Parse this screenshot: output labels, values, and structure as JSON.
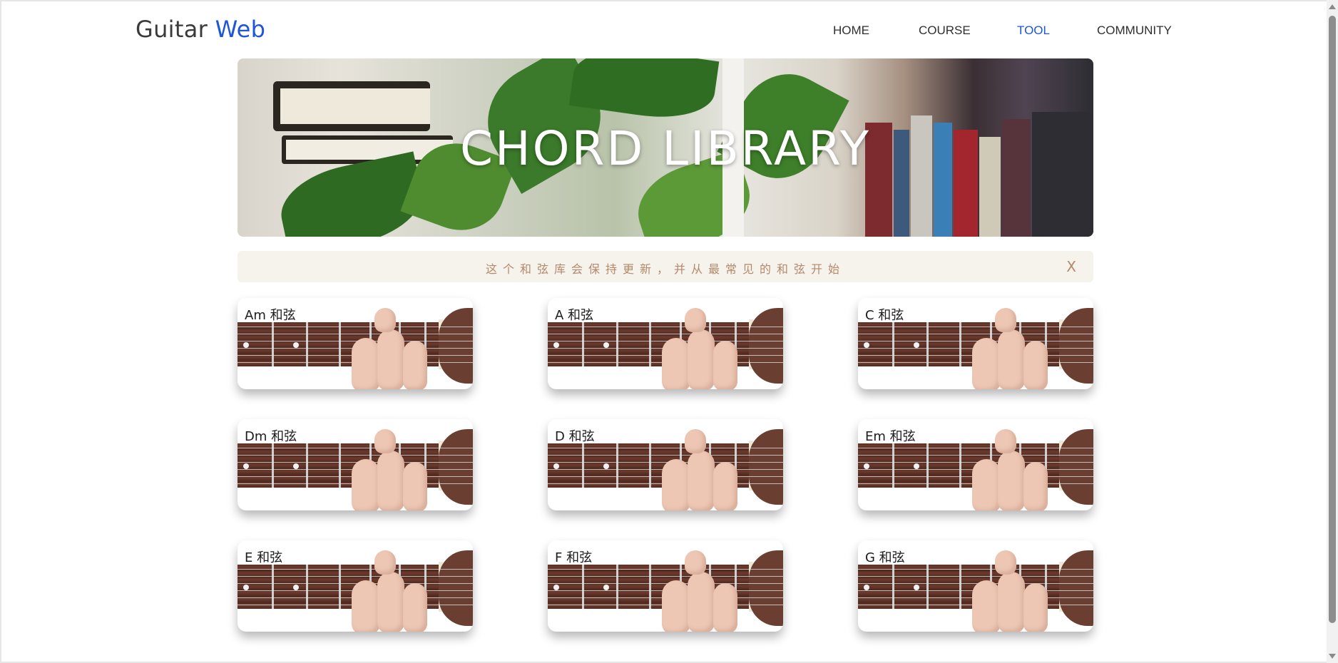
{
  "header": {
    "logo": {
      "part1": "Guitar ",
      "part2": "Web"
    },
    "nav": [
      {
        "label": "HOME",
        "active": false
      },
      {
        "label": "COURSE",
        "active": false
      },
      {
        "label": "TOOL",
        "active": true
      },
      {
        "label": "COMMUNITY",
        "active": false
      }
    ]
  },
  "hero": {
    "title": "CHORD LIBRARY"
  },
  "notice": {
    "text": "这个和弦库会保持更新，并从最常见的和弦开始",
    "close": "X"
  },
  "chords": [
    {
      "label": "Am 和弦"
    },
    {
      "label": "A 和弦"
    },
    {
      "label": "C 和弦"
    },
    {
      "label": "Dm 和弦"
    },
    {
      "label": "D 和弦"
    },
    {
      "label": "Em 和弦"
    },
    {
      "label": "E 和弦"
    },
    {
      "label": "F 和弦"
    },
    {
      "label": "G 和弦"
    }
  ],
  "colors": {
    "accent": "#1f56d8",
    "notice_bg": "#f6f2ec",
    "notice_text": "#b28a6b"
  }
}
